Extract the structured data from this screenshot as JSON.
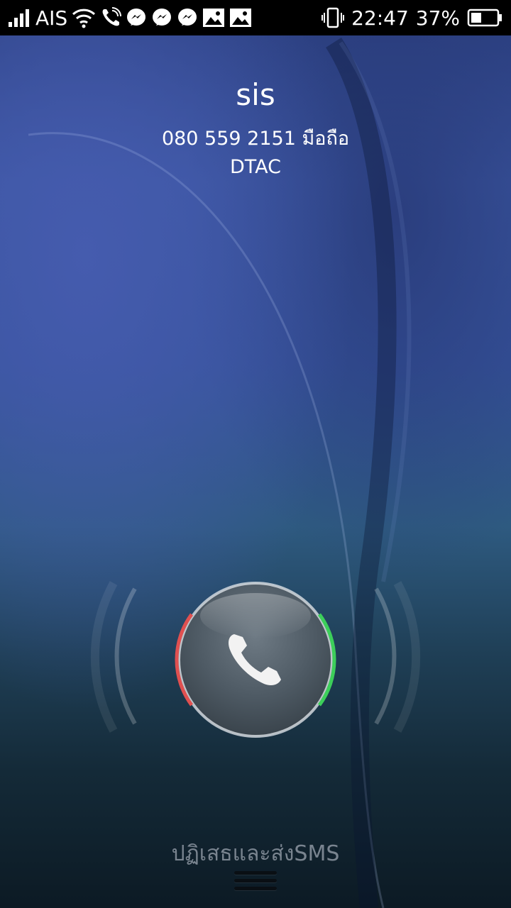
{
  "status_bar": {
    "carrier": "AIS",
    "time": "22:47",
    "battery": "37%",
    "icons": [
      "signal-bars-icon",
      "wifi-icon",
      "phone-call-icon",
      "messenger-icon",
      "messenger-icon",
      "messenger-icon",
      "image-icon",
      "image-icon",
      "vibrate-icon",
      "battery-icon"
    ]
  },
  "call": {
    "name": "sis",
    "number_line": "080 559 2151 มือถือ",
    "carrier": "DTAC"
  },
  "actions": {
    "reject_sms": "ปฏิเสธและส่งSMS"
  },
  "colors": {
    "reject_arc": "#e05050",
    "answer_arc": "#3ccf5a"
  }
}
